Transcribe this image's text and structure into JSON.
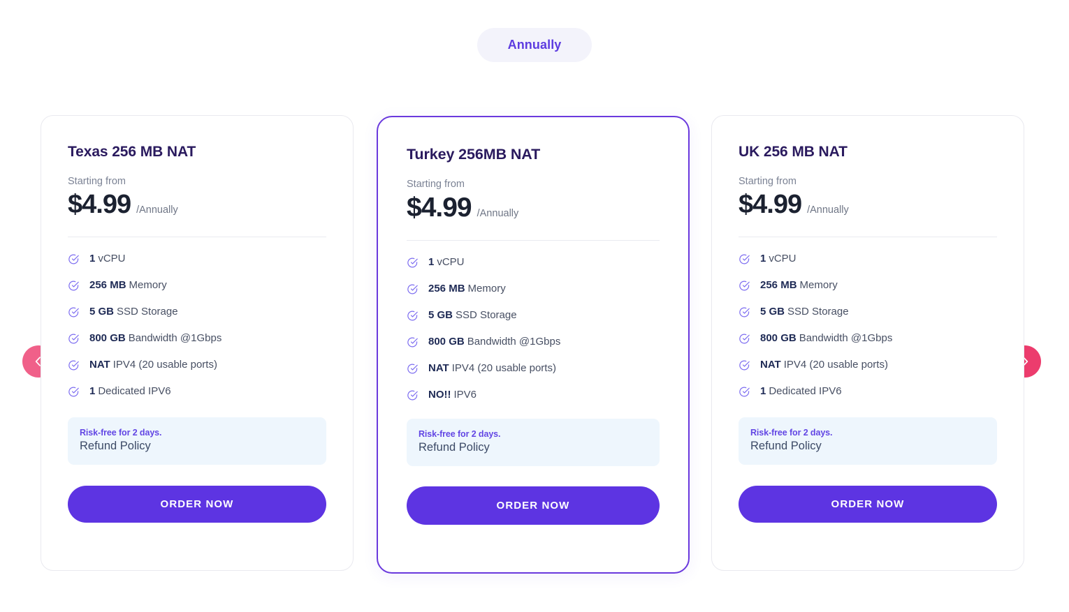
{
  "billing_toggle": {
    "label": "Annually",
    "accent_color": "#5d3ce0",
    "background_color": "#f3f3fb"
  },
  "carousel": {
    "prev_icon": "chevron-left-icon",
    "next_icon": "chevron-right-icon",
    "arrow_color": "#ec3c6d"
  },
  "theme": {
    "primary": "#5d34e2",
    "featured_border": "#6a39dd",
    "title_color": "#2a1a5e",
    "refund_bg": "#eef6fd",
    "refund_accent": "#6246e4"
  },
  "common": {
    "starting_from": "Starting from",
    "period": "/Annually",
    "refund_note": "Risk-free for 2 days.",
    "refund_link": "Refund Policy",
    "order_label": "ORDER NOW",
    "check_icon": "check-circle-icon"
  },
  "plans": [
    {
      "title": "Texas 256 MB NAT",
      "starting_from": "Starting from",
      "price": "$4.99",
      "period": "/Annually",
      "featured": false,
      "features": [
        {
          "strong": "1",
          "rest": "vCPU"
        },
        {
          "strong": "256 MB",
          "rest": "Memory"
        },
        {
          "strong": "5 GB",
          "rest": "SSD Storage"
        },
        {
          "strong": "800 GB",
          "rest": "Bandwidth @1Gbps"
        },
        {
          "strong": "NAT",
          "rest": "IPV4 (20 usable ports)"
        },
        {
          "strong": "1",
          "rest": "Dedicated IPV6"
        }
      ],
      "refund_note": "Risk-free for 2 days.",
      "refund_link": "Refund Policy",
      "order_label": "ORDER NOW"
    },
    {
      "title": "Turkey 256MB NAT",
      "starting_from": "Starting from",
      "price": "$4.99",
      "period": "/Annually",
      "featured": true,
      "features": [
        {
          "strong": "1",
          "rest": "vCPU"
        },
        {
          "strong": "256 MB",
          "rest": "Memory"
        },
        {
          "strong": "5 GB",
          "rest": "SSD Storage"
        },
        {
          "strong": "800 GB",
          "rest": "Bandwidth @1Gbps"
        },
        {
          "strong": "NAT",
          "rest": "IPV4 (20 usable ports)"
        },
        {
          "strong": "NO!!",
          "rest": "IPV6"
        }
      ],
      "refund_note": "Risk-free for 2 days.",
      "refund_link": "Refund Policy",
      "order_label": "ORDER NOW"
    },
    {
      "title": "UK 256 MB NAT",
      "starting_from": "Starting from",
      "price": "$4.99",
      "period": "/Annually",
      "featured": false,
      "features": [
        {
          "strong": "1",
          "rest": "vCPU"
        },
        {
          "strong": "256 MB",
          "rest": "Memory"
        },
        {
          "strong": "5 GB",
          "rest": "SSD Storage"
        },
        {
          "strong": "800 GB",
          "rest": "Bandwidth @1Gbps"
        },
        {
          "strong": "NAT",
          "rest": "IPV4 (20 usable ports)"
        },
        {
          "strong": "1",
          "rest": "Dedicated IPV6"
        }
      ],
      "refund_note": "Risk-free for 2 days.",
      "refund_link": "Refund Policy",
      "order_label": "ORDER NOW"
    }
  ]
}
